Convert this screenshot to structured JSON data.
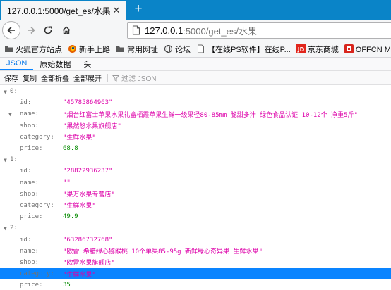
{
  "browser": {
    "tab_title": "127.0.0.1:5000/get_es/水果",
    "tab_close": "✕",
    "new_tab": "+",
    "url_host": "127.0.0.1",
    "url_path": ":5000/get_es/水果"
  },
  "bookmarks": [
    {
      "label": "火狐官方站点",
      "icon": "folder-icon"
    },
    {
      "label": "新手上路",
      "icon": "firefox-icon"
    },
    {
      "label": "常用网址",
      "icon": "folder-icon"
    },
    {
      "label": "论坛",
      "icon": "globe-icon"
    },
    {
      "label": "【在线PS软件】在线P...",
      "icon": "page-icon"
    },
    {
      "label": "京东商城",
      "icon": "jd-icon"
    },
    {
      "label": "OFFCN MIS-登录",
      "icon": "offcn-icon"
    }
  ],
  "viewer": {
    "tabs": [
      "JSON",
      "原始数据",
      "头"
    ],
    "toolbar": {
      "save": "保存",
      "copy": "复制",
      "collapse_all": "全部折叠",
      "expand_all": "全部展开",
      "filter_placeholder": "过滤 JSON"
    }
  },
  "items": [
    {
      "index": "0:",
      "fields": [
        {
          "key": "id:",
          "value": "\"45785864963\"",
          "type": "str"
        },
        {
          "key": "name:",
          "value": "\"烟台红富士苹果水果礼盒栖霞苹果生鲜一级果径80-85mm 脆甜多汁 绿色食品认证 10-12个 净重5斤\"",
          "type": "str",
          "twisty": true
        },
        {
          "key": "shop:",
          "value": "\"果然悠水果旗舰店\"",
          "type": "str"
        },
        {
          "key": "category:",
          "value": "\"生鲜水果\"",
          "type": "str"
        },
        {
          "key": "price:",
          "value": "68.8",
          "type": "num"
        }
      ]
    },
    {
      "index": "1:",
      "fields": [
        {
          "key": "id:",
          "value": "\"28822936237\"",
          "type": "str"
        },
        {
          "key": "name:",
          "value": "\"\"",
          "type": "str"
        },
        {
          "key": "shop:",
          "value": "\"果万水果专营店\"",
          "type": "str"
        },
        {
          "key": "category:",
          "value": "\"生鲜水果\"",
          "type": "str"
        },
        {
          "key": "price:",
          "value": "49.9",
          "type": "num"
        }
      ]
    },
    {
      "index": "2:",
      "fields": [
        {
          "key": "id:",
          "value": "\"63286732768\"",
          "type": "str"
        },
        {
          "key": "name:",
          "value": "\"欧雷 希腊绿心猕猴桃 10个单果85-95g 新鲜绿心奇异果 生鲜水果\"",
          "type": "str"
        },
        {
          "key": "shop:",
          "value": "\"欧雷水果旗舰店\"",
          "type": "str"
        },
        {
          "key": "category:",
          "value": "\"生鲜水果\"",
          "type": "str",
          "selected": true
        },
        {
          "key": "price:",
          "value": "35",
          "type": "num"
        }
      ]
    }
  ]
}
